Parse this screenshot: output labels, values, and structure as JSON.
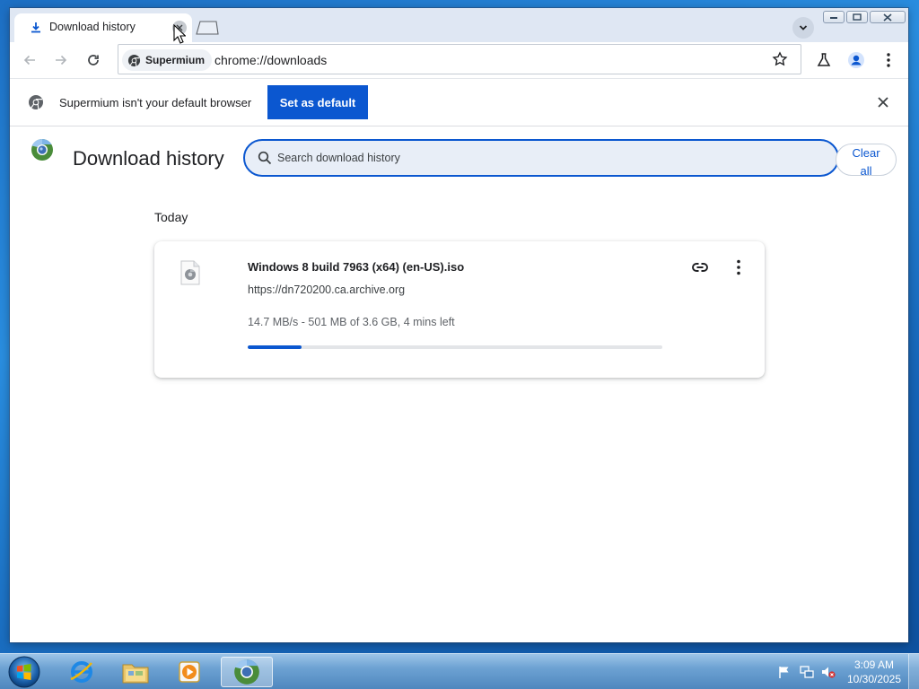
{
  "tab": {
    "title": "Download history"
  },
  "toolbar": {
    "site_chip": "Supermium",
    "url": "chrome://downloads"
  },
  "infobar": {
    "message": "Supermium isn't your default browser",
    "button_label": "Set as default"
  },
  "page": {
    "title": "Download history",
    "search_placeholder": "Search download history",
    "clear_all_line1": "Clear",
    "clear_all_line2": "all",
    "section_date": "Today"
  },
  "download": {
    "file_name": "Windows 8 build 7963 (x64) (en-US).iso",
    "source_url": "https://dn720200.ca.archive.org",
    "status": "14.7 MB/s - 501 MB of 3.6 GB, 4 mins left",
    "progress_fraction": 0.13
  },
  "taskbar": {
    "time": "3:09 AM",
    "date": "10/30/2025"
  },
  "colors": {
    "accent": "#0b57d0",
    "tab_strip": "#dfe7f3"
  }
}
